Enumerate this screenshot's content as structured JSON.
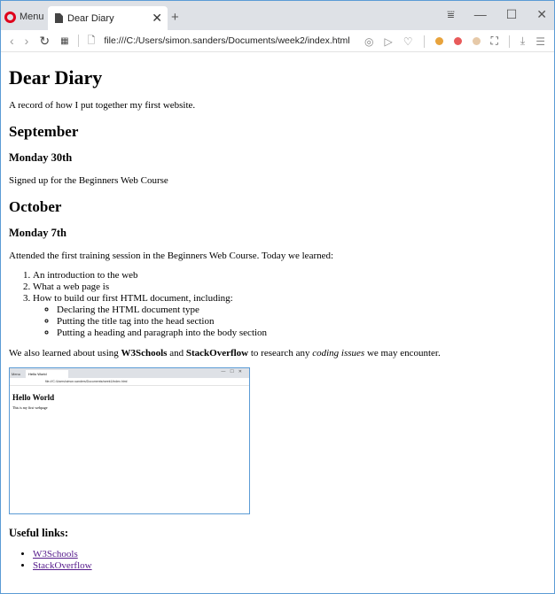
{
  "browser": {
    "menu_label": "Menu",
    "tab_title": "Dear Diary",
    "tab_close": "✕",
    "new_tab": "+",
    "url": "file:///C:/Users/simon.sanders/Documents/week2/index.html",
    "win_menu": "⩸",
    "win_min": "—",
    "win_max": "☐",
    "win_close": "✕"
  },
  "page": {
    "title": "Dear Diary",
    "intro": "A record of how I put together my first website.",
    "september": {
      "heading": "September",
      "day": "Monday 30th",
      "text": "Signed up for the Beginners Web Course"
    },
    "october": {
      "heading": "October",
      "day": "Monday 7th",
      "text": "Attended the first training session in the Beginners Web Course. Today we learned:",
      "list": [
        "An introduction to the web",
        "What a web page is",
        "How to build our first HTML document, including:"
      ],
      "sublist": [
        "Declaring the HTML document type",
        "Putting the title tag into the head section",
        "Putting a heading and paragraph into the body section"
      ]
    },
    "learned": {
      "pre": "We also learned about using ",
      "w3": "W3Schools",
      "and": " and ",
      "so": "StackOverflow",
      "mid": " to research any ",
      "em": "coding issues",
      "post": " we may encounter."
    },
    "screenshot": {
      "menu": "Menu",
      "tab": "Hello World",
      "url": "file:///C:/Users/simon.sanders/Documents/week1/index.html",
      "heading": "Hello World",
      "text": "This is my first webpage"
    },
    "useful_heading": "Useful links:",
    "links": [
      "W3Schools",
      "StackOverflow"
    ]
  }
}
